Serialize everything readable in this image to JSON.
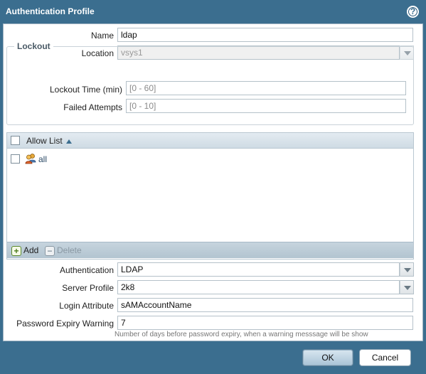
{
  "dialog": {
    "title": "Authentication Profile",
    "help_glyph": "?"
  },
  "form": {
    "name": {
      "label": "Name",
      "value": "ldap"
    },
    "location": {
      "label": "Location",
      "value": "vsys1"
    }
  },
  "lockout": {
    "legend": "Lockout",
    "lockout_time": {
      "label": "Lockout Time (min)",
      "placeholder": "[0 - 60]"
    },
    "failed_attempts": {
      "label": "Failed Attempts",
      "placeholder": "[0 - 10]"
    }
  },
  "allow_list": {
    "header": "Allow List",
    "rows": [
      {
        "label": "all",
        "icon": "user-group-icon"
      }
    ],
    "add_label": "Add",
    "delete_label": "Delete"
  },
  "settings": {
    "authentication": {
      "label": "Authentication",
      "value": "LDAP"
    },
    "server_profile": {
      "label": "Server Profile",
      "value": "2k8"
    },
    "login_attribute": {
      "label": "Login Attribute",
      "value": "sAMAccountName"
    },
    "password_expiry_warning": {
      "label": "Password Expiry Warning",
      "value": "7",
      "hint": "Number of days before password expiry, when a warning messsage will be show"
    }
  },
  "buttons": {
    "ok": "OK",
    "cancel": "Cancel"
  },
  "colors": {
    "frame": "#3b6e8f",
    "grid_header": "#cfdbe4",
    "toolbar": "#b2c4d0"
  }
}
